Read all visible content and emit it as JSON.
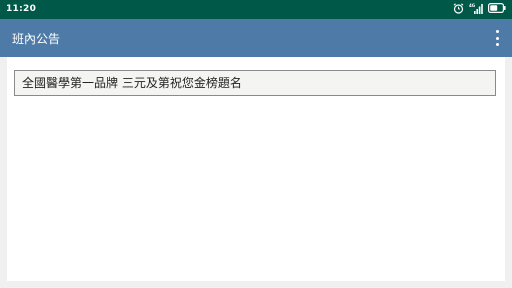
{
  "status_bar": {
    "time": "11:20",
    "icons": [
      "alarm-icon",
      "signal-icon",
      "battery-icon"
    ],
    "background_color": "#005848"
  },
  "app_bar": {
    "title": "班內公告",
    "background_color": "#4d7aa6",
    "overflow_icon": "more-vert-icon"
  },
  "content": {
    "announcements": [
      "全國醫學第一品牌 三元及第祝您金榜題名"
    ]
  }
}
